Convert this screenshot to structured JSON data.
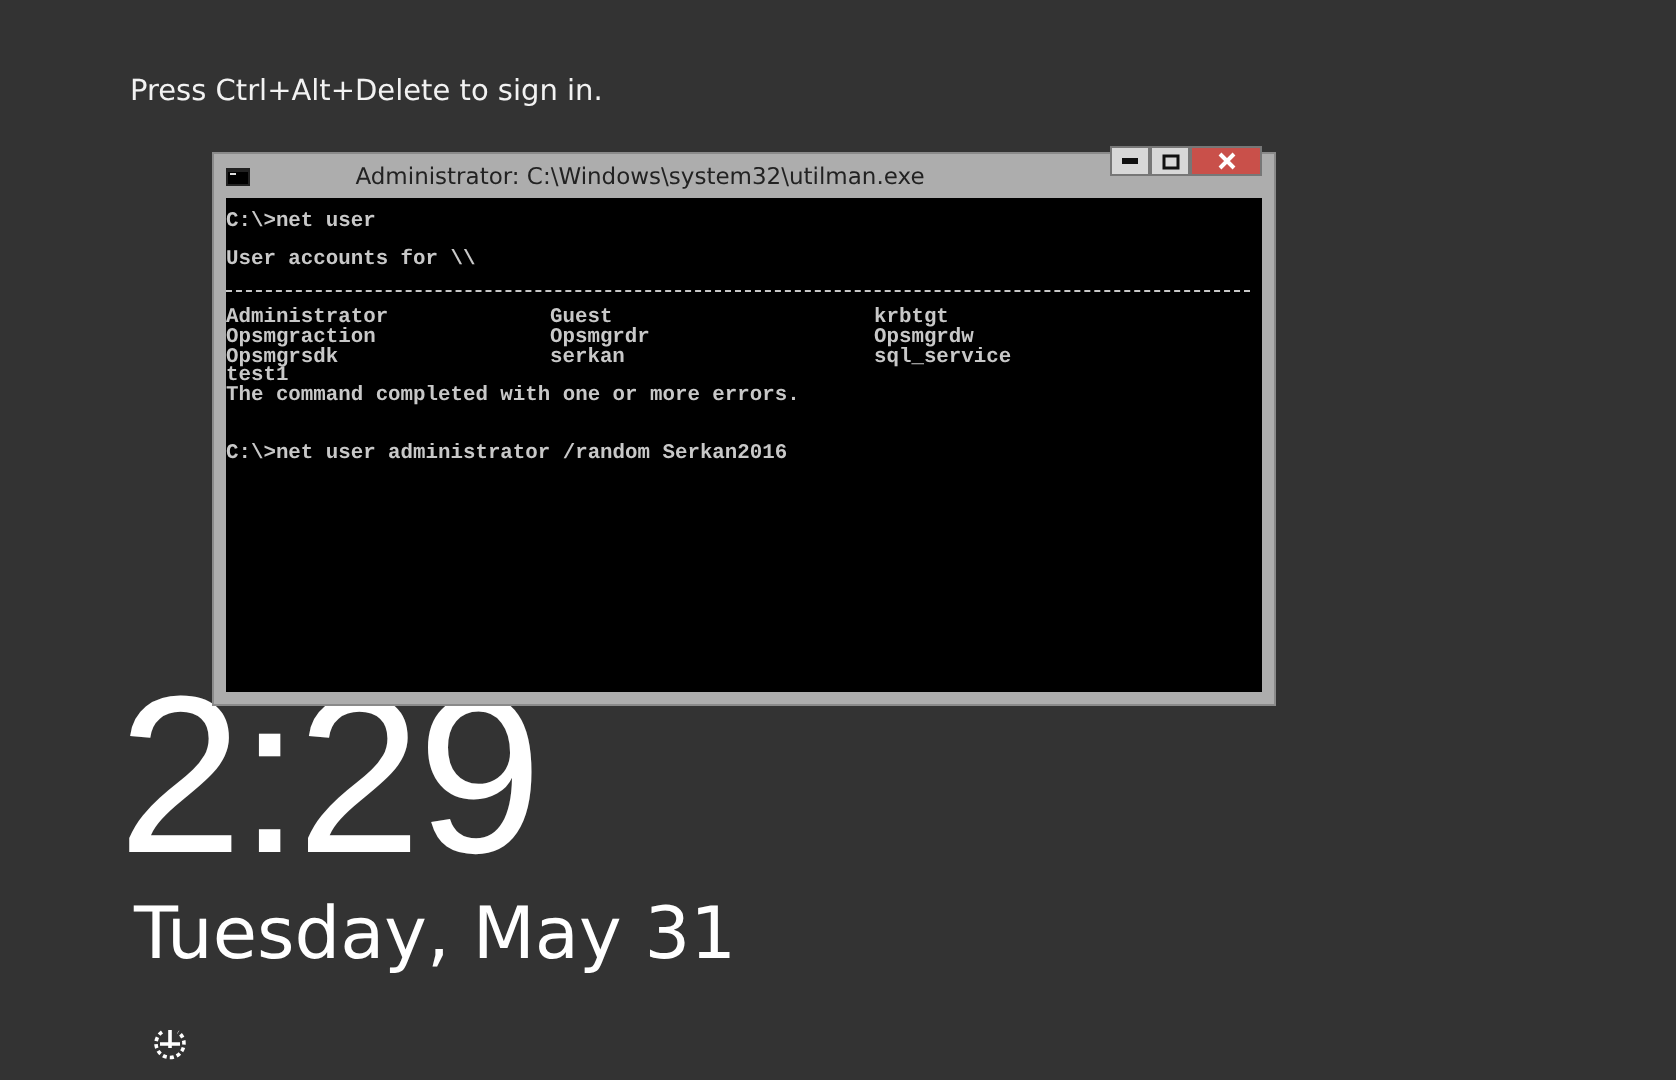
{
  "lock_screen": {
    "prompt": "Press Ctrl+Alt+Delete to sign in.",
    "time": "2:29",
    "date": "Tuesday, May 31"
  },
  "console_window": {
    "title": "Administrator: C:\\Windows\\system32\\utilman.exe",
    "blocks": [
      {
        "kind": "lines",
        "lines": [
          "C:\\>net user"
        ]
      },
      {
        "kind": "lines",
        "lines": [
          "User accounts for \\\\"
        ]
      },
      {
        "kind": "table",
        "rows": [
          [
            "Administrator",
            "Guest",
            "krbtgt"
          ],
          [
            "Opsmgraction",
            "Opsmgrdr",
            "Opsmgrdw"
          ],
          [
            "Opsmgrsdk",
            "serkan",
            "sql_service"
          ],
          [
            "test1"
          ]
        ],
        "after": [
          "The command completed with one or more errors."
        ]
      },
      {
        "kind": "lines",
        "lines": [
          "C:\\>net user administrator /random Serkan2016"
        ]
      }
    ]
  }
}
